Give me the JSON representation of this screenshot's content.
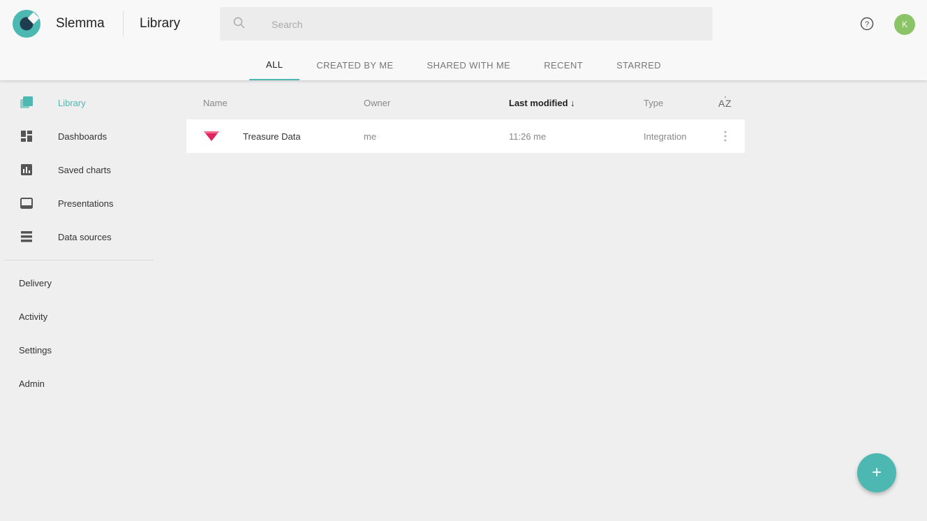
{
  "app": {
    "brand": "Slemma",
    "page_title": "Library",
    "accent_color": "#4db8b1"
  },
  "search": {
    "placeholder": "Search",
    "value": ""
  },
  "user": {
    "avatar_initial": "K",
    "avatar_color": "#8bc466"
  },
  "tabs": [
    {
      "label": "ALL",
      "active": true
    },
    {
      "label": "CREATED BY ME",
      "active": false
    },
    {
      "label": "SHARED WITH ME",
      "active": false
    },
    {
      "label": "RECENT",
      "active": false
    },
    {
      "label": "STARRED",
      "active": false
    }
  ],
  "sidebar": {
    "items": [
      {
        "label": "Library",
        "icon": "library-icon",
        "active": true
      },
      {
        "label": "Dashboards",
        "icon": "dashboards-icon",
        "active": false
      },
      {
        "label": "Saved charts",
        "icon": "saved-charts-icon",
        "active": false
      },
      {
        "label": "Presentations",
        "icon": "presentations-icon",
        "active": false
      },
      {
        "label": "Data sources",
        "icon": "data-sources-icon",
        "active": false
      }
    ],
    "secondary": [
      {
        "label": "Delivery"
      },
      {
        "label": "Activity"
      },
      {
        "label": "Settings"
      },
      {
        "label": "Admin"
      }
    ]
  },
  "table": {
    "columns": {
      "name": "Name",
      "owner": "Owner",
      "last_modified": "Last modified ↓",
      "type": "Type"
    },
    "sort_icon": "sort-az-icon",
    "rows": [
      {
        "name": "Treasure Data",
        "owner": "me",
        "last_modified": "11:26 me",
        "type": "Integration",
        "icon": "treasure-data-icon",
        "icon_color": "#e0245e"
      }
    ]
  },
  "fab": {
    "label": "+"
  }
}
